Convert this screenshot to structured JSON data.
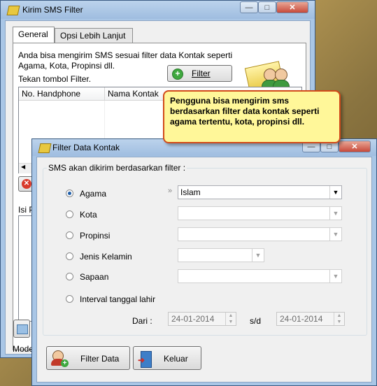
{
  "main_window": {
    "title": "Kirim SMS Filter",
    "tabs": [
      "General",
      "Opsi Lebih Lanjut"
    ],
    "description": "Anda bisa mengirim SMS sesuai filter data Kontak seperti Agama, Kota, Propinsi dll.",
    "instruction": "Tekan tombol Filter.",
    "filter_button": "Filter",
    "table_headers": [
      "No. Handphone",
      "Nama Kontak"
    ],
    "isi_label": "Isi P",
    "status_text": "Mode"
  },
  "callout": {
    "text": "Pengguna bisa mengirim sms berdasarkan filter data kontak seperti agama tertentu, kota, propinsi dll."
  },
  "filter_dialog": {
    "title": "Filter Data Kontak",
    "group_label": "SMS akan dikirim berdasarkan filter :",
    "options": [
      {
        "label": "Agama",
        "selected": true,
        "value": "Islam",
        "enabled": true
      },
      {
        "label": "Kota",
        "selected": false,
        "value": "",
        "enabled": false
      },
      {
        "label": "Propinsi",
        "selected": false,
        "value": "",
        "enabled": false
      },
      {
        "label": "Jenis Kelamin",
        "selected": false,
        "value": "",
        "enabled": false
      },
      {
        "label": "Sapaan",
        "selected": false,
        "value": "",
        "enabled": false
      },
      {
        "label": "Interval tanggal lahir",
        "selected": false
      }
    ],
    "dari_label": "Dari :",
    "date_from": "24-01-2014",
    "sd_label": "s/d",
    "date_to": "24-01-2014",
    "filter_data_button": "Filter Data",
    "keluar_button": "Keluar"
  },
  "colors": {
    "titlebar": "#a9c6e6",
    "callout_bg": "#fff799",
    "callout_border": "#d24a1a",
    "arrow": "#e02020",
    "radio_dot": "#1f5ea8"
  }
}
